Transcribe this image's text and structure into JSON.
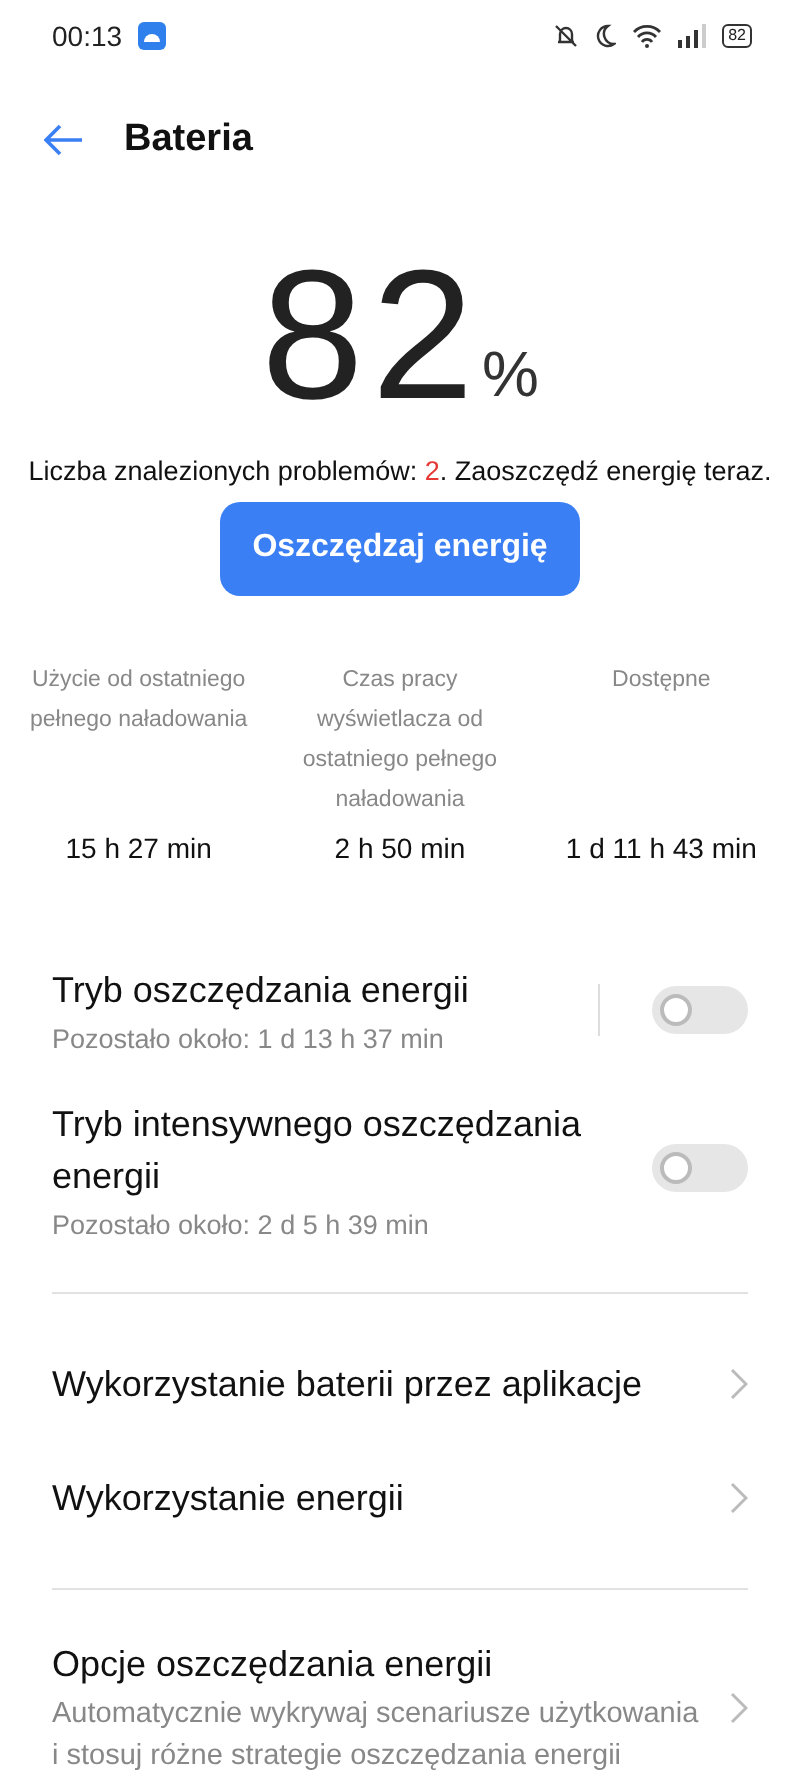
{
  "status_bar": {
    "time": "00:13",
    "battery": "82"
  },
  "header": {
    "title": "Bateria"
  },
  "battery": {
    "value": "82",
    "unit": "%"
  },
  "problems": {
    "text": "Liczba znalezionych problemów: ",
    "count": "2",
    "suffix": ". Zaoszczędź energię teraz."
  },
  "save_button": "Oszczędzaj energię",
  "stats": [
    {
      "label": "Użycie od ostatniego pełnego naładowania",
      "value": "15 h 27 min"
    },
    {
      "label": "Czas pracy wyświetlacza od ostatniego pełnego naładowania",
      "value": "2 h 50 min"
    },
    {
      "label": "Dostępne",
      "value": "1 d 11 h 43 min"
    }
  ],
  "toggles": [
    {
      "title": "Tryb oszczędzania energii",
      "subtitle": "Pozostało około:  1 d 13 h 37 min",
      "on": false,
      "separator": true
    },
    {
      "title": "Tryb intensywnego oszczędzania energii",
      "subtitle": "Pozostało około:  2 d 5 h 39 min",
      "on": false,
      "separator": false
    }
  ],
  "links": [
    {
      "title": "Wykorzystanie baterii przez aplikacje"
    },
    {
      "title": "Wykorzystanie energii"
    }
  ],
  "options": {
    "title": "Opcje oszczędzania energii",
    "subtitle": "Automatycznie wykrywaj scenariusze użytkowania i stosuj różne strategie oszczędzania energii"
  }
}
